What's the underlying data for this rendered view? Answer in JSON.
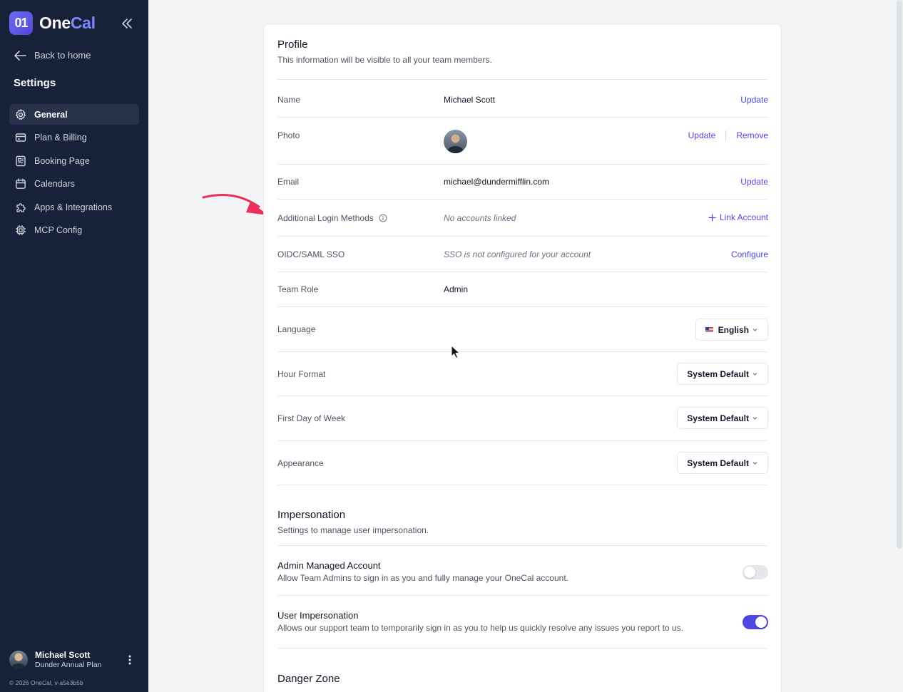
{
  "app": {
    "logo_mark": "01",
    "logo_text_a": "One",
    "logo_text_b": "Cal"
  },
  "sidebar": {
    "back_label": "Back to home",
    "title": "Settings",
    "items": [
      {
        "label": "General",
        "icon": "gear-icon",
        "active": true
      },
      {
        "label": "Plan & Billing",
        "icon": "credit-card-icon"
      },
      {
        "label": "Booking Page",
        "icon": "booking-page-icon"
      },
      {
        "label": "Calendars",
        "icon": "calendar-icon"
      },
      {
        "label": "Apps & Integrations",
        "icon": "puzzle-icon"
      },
      {
        "label": "MCP Config",
        "icon": "chip-icon"
      }
    ],
    "user": {
      "name": "Michael Scott",
      "plan": "Dunder Annual Plan"
    },
    "copyright": "© 2026 OneCal, v-a5e3b5b"
  },
  "profile": {
    "title": "Profile",
    "subtitle": "This information will be visible to all your team members.",
    "name": {
      "label": "Name",
      "value": "Michael Scott",
      "action": "Update"
    },
    "photo": {
      "label": "Photo",
      "update": "Update",
      "remove": "Remove"
    },
    "email": {
      "label": "Email",
      "value": "michael@dundermifflin.com",
      "action": "Update"
    },
    "login": {
      "label": "Additional Login Methods",
      "value": "No accounts linked",
      "action": "Link Account"
    },
    "sso": {
      "label": "OIDC/SAML SSO",
      "value": "SSO is not configured for your account",
      "action": "Configure"
    },
    "role": {
      "label": "Team Role",
      "value": "Admin"
    },
    "language": {
      "label": "Language",
      "value": "English"
    },
    "hour_format": {
      "label": "Hour Format",
      "value": "System Default"
    },
    "first_day": {
      "label": "First Day of Week",
      "value": "System Default"
    },
    "appearance": {
      "label": "Appearance",
      "value": "System Default"
    }
  },
  "impersonation": {
    "title": "Impersonation",
    "subtitle": "Settings to manage user impersonation.",
    "admin_managed": {
      "title": "Admin Managed Account",
      "desc": "Allow Team Admins to sign in as you and fully manage your OneCal account.",
      "enabled": false
    },
    "user_impersonation": {
      "title": "User Impersonation",
      "desc": "Allows our support team to temporarily sign in as you to help us quickly resolve any issues you report to us.",
      "enabled": true
    }
  },
  "danger": {
    "title": "Danger Zone"
  },
  "colors": {
    "accent": "#4f46e5",
    "sidebar_bg": "#17223a",
    "annotation_arrow": "#e8305a"
  }
}
